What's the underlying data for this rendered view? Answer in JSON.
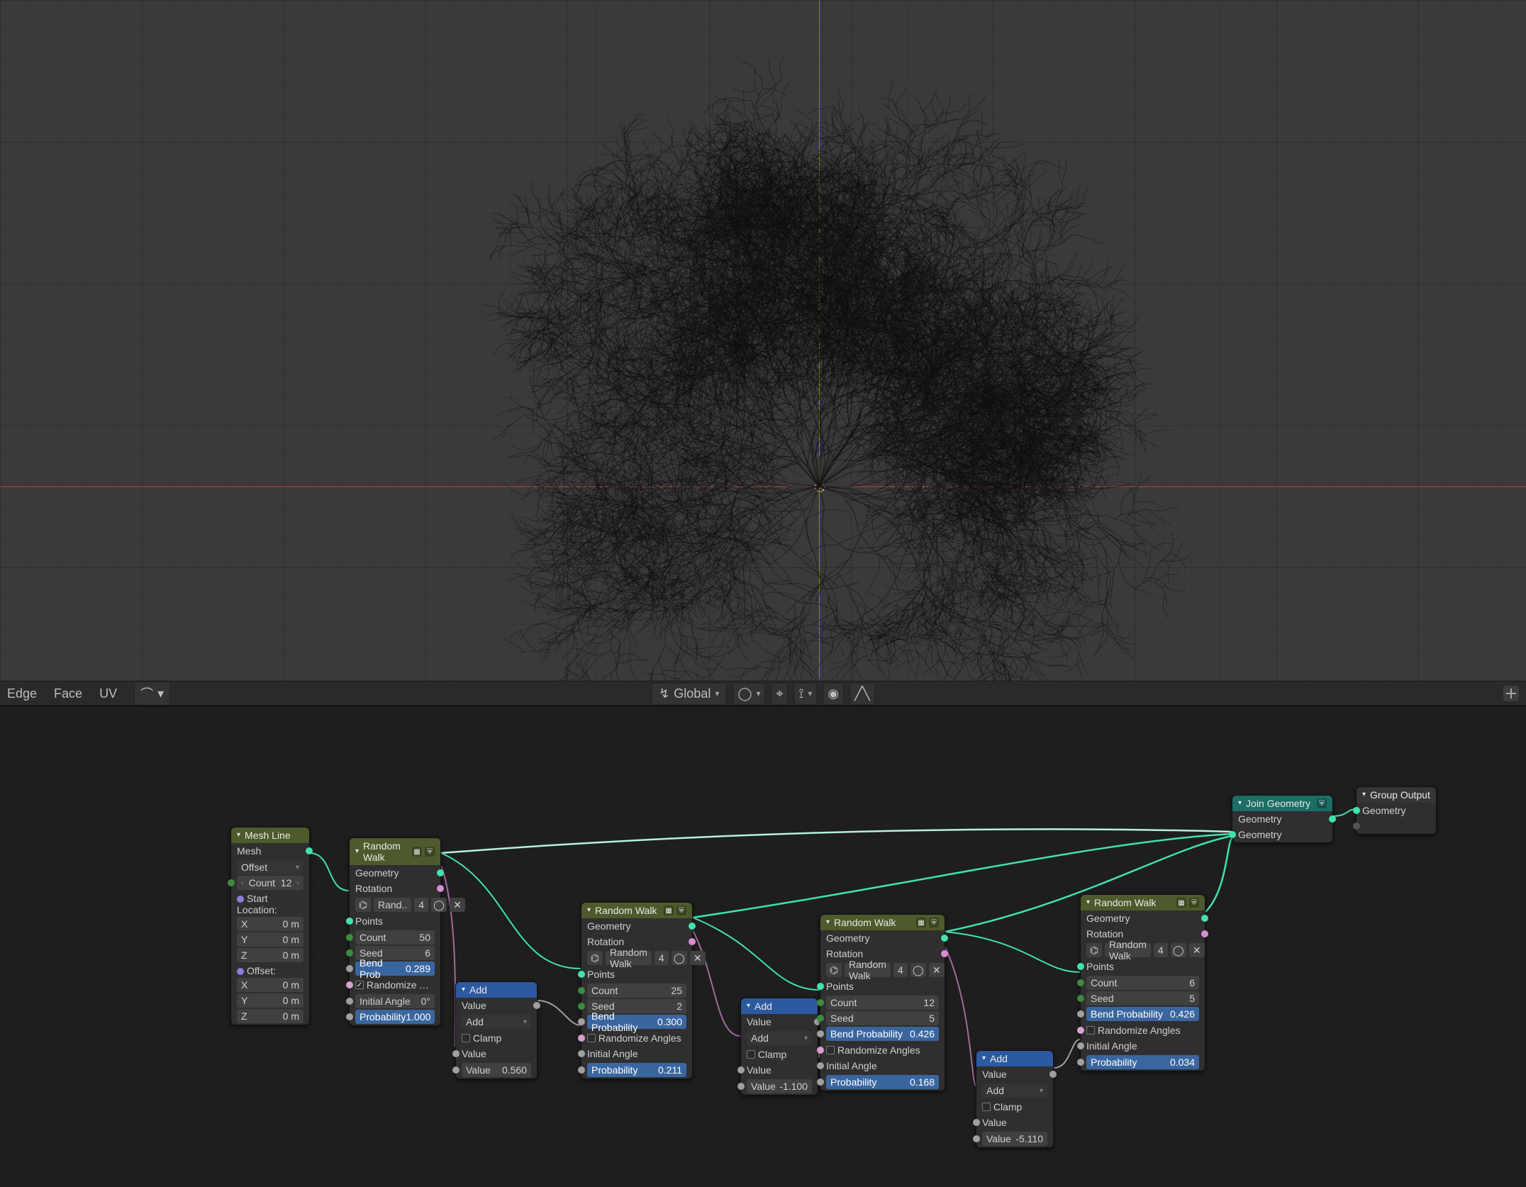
{
  "midbar": {
    "edge": "Edge",
    "face": "Face",
    "uv": "UV",
    "orientation_label": "Global",
    "orientation_icon": "↯",
    "pivot_icon": "◯",
    "snap_icon": "⌖",
    "snap_target_icon": "⟟",
    "prop_edit_icon": "◉",
    "curve_icon": "╱╲"
  },
  "nodes": {
    "mesh_line": {
      "title": "Mesh Line",
      "out_mesh": "Mesh",
      "mode": "Offset",
      "count_label": "Count",
      "count_value": "12",
      "start_label": "Start Location:",
      "x_label": "X",
      "x_value": "0 m",
      "y_label": "Y",
      "y_value": "0 m",
      "z_label": "Z",
      "z_value": "0 m",
      "offset_label": "Offset:",
      "ox_label": "X",
      "ox_value": "0 m",
      "oy_label": "Y",
      "oy_value": "0 m",
      "oz_label": "Z",
      "oz_value": "0 m"
    },
    "rw1": {
      "title": "Random Walk",
      "out_geo": "Geometry",
      "out_rot": "Rotation",
      "link_text": "Rand..",
      "link_num": "4",
      "points_label": "Points",
      "count_label": "Count",
      "count_value": "50",
      "seed_label": "Seed",
      "seed_value": "6",
      "bendprob_label": "Bend Prob",
      "bendprob_value": "0.289",
      "randang_label": "Randomize Angles",
      "initang_label": "Initial Angle",
      "initang_value": "0°",
      "prob_label": "Probability",
      "prob_value": "1.000"
    },
    "rw2": {
      "title": "Random Walk",
      "out_geo": "Geometry",
      "out_rot": "Rotation",
      "link_text": "Random Walk",
      "link_num": "4",
      "points_label": "Points",
      "count_label": "Count",
      "count_value": "25",
      "seed_label": "Seed",
      "seed_value": "2",
      "bendprob_label": "Bend Probability",
      "bendprob_value": "0.300",
      "randang_label": "Randomize Angles",
      "initang_label": "Initial Angle",
      "prob_label": "Probability",
      "prob_value": "0.211"
    },
    "rw3": {
      "title": "Random Walk",
      "out_geo": "Geometry",
      "out_rot": "Rotation",
      "link_text": "Random Walk",
      "link_num": "4",
      "points_label": "Points",
      "count_label": "Count",
      "count_value": "12",
      "seed_label": "Seed",
      "seed_value": "5",
      "bendprob_label": "Bend Probability",
      "bendprob_value": "0.426",
      "randang_label": "Randomize Angles",
      "initang_label": "Initial Angle",
      "prob_label": "Probability",
      "prob_value": "0.168"
    },
    "rw4": {
      "title": "Random Walk",
      "out_geo": "Geometry",
      "out_rot": "Rotation",
      "link_text": "Random Walk",
      "link_num": "4",
      "points_label": "Points",
      "count_label": "Count",
      "count_value": "6",
      "seed_label": "Seed",
      "seed_value": "5",
      "bendprob_label": "Bend Probability",
      "bendprob_value": "0.426",
      "randang_label": "Randomize Angles",
      "initang_label": "Initial Angle",
      "prob_label": "Probability",
      "prob_value": "0.034"
    },
    "add1": {
      "title": "Add",
      "out": "Value",
      "op": "Add",
      "clamp": "Clamp",
      "val_label": "Value",
      "val2_label": "Value",
      "val2": "0.560"
    },
    "add2": {
      "title": "Add",
      "out": "Value",
      "op": "Add",
      "clamp": "Clamp",
      "val_label": "Value",
      "val2_label": "Value",
      "val2": "-1.100"
    },
    "add3": {
      "title": "Add",
      "out": "Value",
      "op": "Add",
      "clamp": "Clamp",
      "val_label": "Value",
      "val2_label": "Value",
      "val2": "-5.110"
    },
    "join": {
      "title": "Join Geometry",
      "out": "Geometry",
      "in": "Geometry"
    },
    "group_out": {
      "title": "Group Output",
      "in": "Geometry"
    }
  }
}
